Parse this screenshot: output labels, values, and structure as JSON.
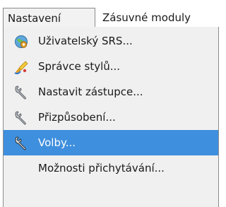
{
  "menubar": {
    "items": [
      {
        "label": "Nastavení",
        "active": true
      },
      {
        "label": "Zásuvné moduly",
        "active": false
      }
    ]
  },
  "menu": {
    "items": [
      {
        "label": "Uživatelský SRS...",
        "icon": "globe-settings-icon",
        "selected": false
      },
      {
        "label": "Správce stylů...",
        "icon": "paintbrush-icon",
        "selected": false
      },
      {
        "label": "Nastavit zástupce...",
        "icon": "wrench-icon",
        "selected": false
      },
      {
        "label": "Přizpůsobení...",
        "icon": "wrench-icon",
        "selected": false
      },
      {
        "label": "Volby...",
        "icon": "wrench-icon",
        "selected": true
      },
      {
        "label": "Možnosti přichytávání...",
        "icon": "",
        "selected": false
      }
    ]
  },
  "colors": {
    "selection": "#3e8fde",
    "menu_background": "#f0f0f0",
    "menu_border": "#8a8a8a"
  }
}
